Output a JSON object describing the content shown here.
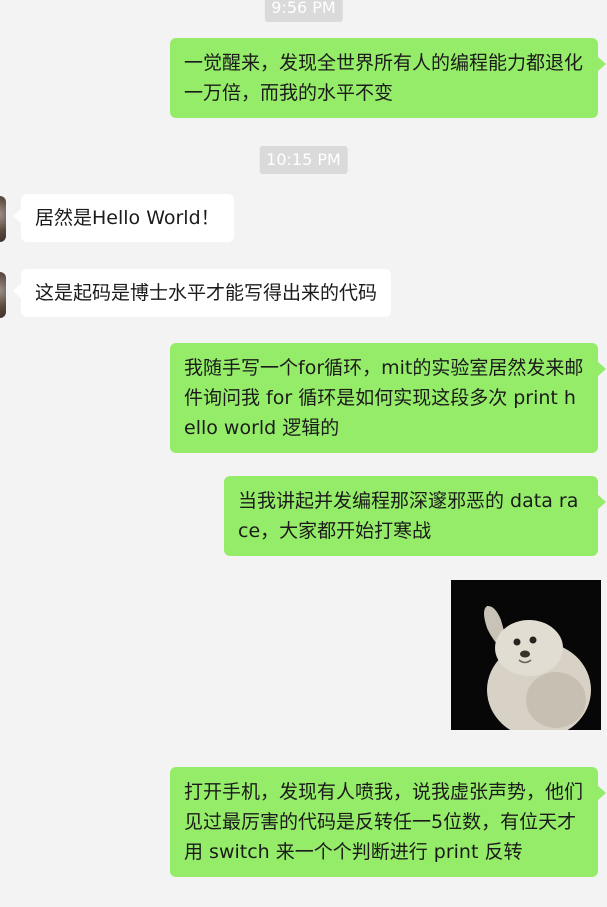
{
  "timestamps": [
    "9:56 PM",
    "10:15 PM"
  ],
  "messages": [
    {
      "side": "out",
      "text": "一觉醒来，发现全世界所有人的编程能力都退化一万倍，而我的水平不变"
    },
    {
      "side": "in",
      "text": "居然是Hello World！"
    },
    {
      "side": "in",
      "text": "这是起码是博士水平才能写得出来的代码"
    },
    {
      "side": "out",
      "text": "我随手写一个for循环，mit的实验室居然发来邮件询问我 for 循环是如何实现这段多次 print hello world 逻辑的"
    },
    {
      "side": "out",
      "text": "当我讲起并发编程那深邃邪恶的 data race，大家都开始打寒战"
    },
    {
      "side": "out",
      "text": "打开手机，发现有人喷我，说我虚张声势，他们见过最厉害的代码是反转任一5位数，有位天才用 switch 来一个个判断进行 print 反转"
    }
  ],
  "sticker": {
    "description_icon": "seal-waving-sticker"
  },
  "colors": {
    "background": "#f3f3f3",
    "outgoing_bubble": "#95ec69",
    "incoming_bubble": "#ffffff",
    "timestamp_bg": "#dadada"
  }
}
